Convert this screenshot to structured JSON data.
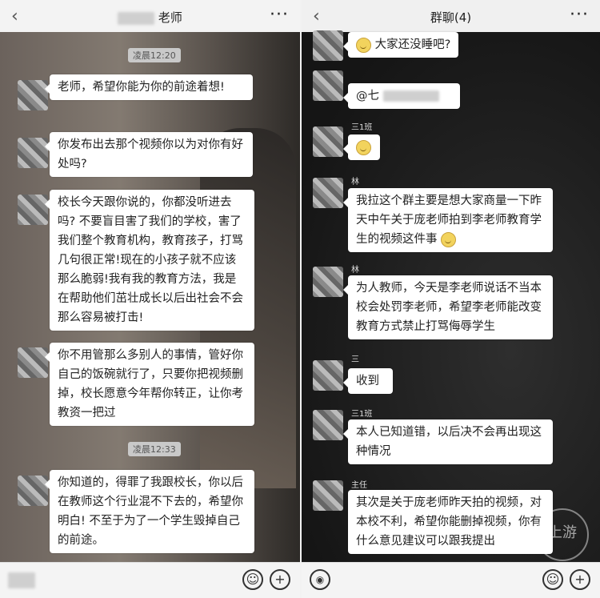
{
  "left": {
    "title_suffix": "老师",
    "more_icon": "more-dots-icon",
    "timestamps": [
      "凌晨12:20",
      "凌晨12:33"
    ],
    "messages": [
      "老师，希望你能为你的前途着想!",
      "你发布出去那个视频你以为对你有好处吗?",
      "校长今天跟你说的，你都没听进去吗? 不要盲目害了我们的学校，害了我们整个教育机构，教育孩子，打骂几句很正常!现在的小孩子就不应该那么脆弱!我有我的教育方法，我是在帮助他们茁壮成长以后出社会不会那么容易被打击!",
      "你不用管那么多别人的事情，管好你自己的饭碗就行了，只要你把视频删掉，校长愿意今年帮你转正，让你考教资一把过",
      "你知道的，得罪了我跟校长，你以后在教师这个行业混不下去的，希望你明白! 不至于为了一个学生毁掉自己的前途。"
    ]
  },
  "right": {
    "title": "群聊(4)",
    "senders": [
      "三1班",
      "林",
      "林",
      "三",
      "三1班",
      "主任"
    ],
    "messages": [
      "大家还没睡吧?",
      "@七",
      "我拉这个群主要是想大家商量一下昨天中午关于庞老师拍到李老师教育学生的视频这件事",
      "为人教师，今天是李老师说话不当本校会处罚李老师，希望李老师能改变教育方式禁止打骂侮辱学生",
      "收到",
      "本人已知道错，以后决不会再出现这种情况",
      "其次是关于庞老师昨天拍的视频，对本校不利，希望你能删掉视频，你有什么意见建议可以跟我提出"
    ],
    "watermark": "上游"
  }
}
